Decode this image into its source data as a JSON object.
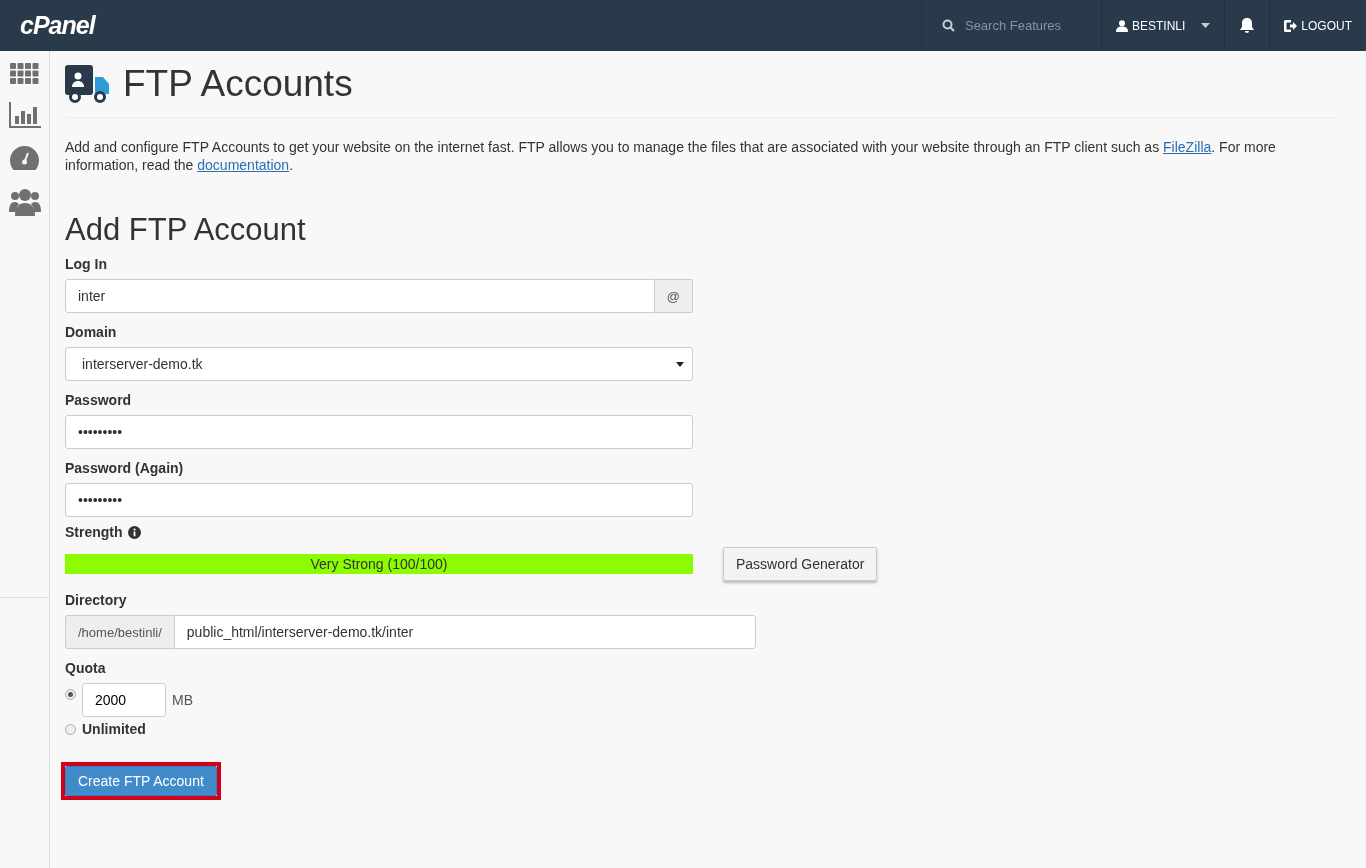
{
  "header": {
    "logo": "cPanel",
    "search": {
      "placeholder": "Search Features"
    },
    "user": "BESTINLI",
    "logout": "LOGOUT"
  },
  "page": {
    "title": "FTP Accounts",
    "intro": [
      {
        "kind": "text",
        "text": "Add and configure FTP Accounts to get your website on the internet fast. FTP allows you to manage the files that are associated with your website through an FTP client such as "
      },
      {
        "kind": "link",
        "text": "FileZilla"
      },
      {
        "kind": "text",
        "text": ". For more information, read the "
      },
      {
        "kind": "link",
        "text": "documentation"
      },
      {
        "kind": "text",
        "text": "."
      }
    ]
  },
  "form": {
    "title": "Add FTP Account",
    "login": {
      "label": "Log In",
      "value": "inter",
      "addon": "@"
    },
    "domain": {
      "label": "Domain",
      "value": "interserver-demo.tk"
    },
    "password": {
      "label": "Password",
      "value": "•••••••••"
    },
    "password_again": {
      "label": "Password (Again)",
      "value": "•••••••••"
    },
    "strength": {
      "label": "Strength",
      "level": 1.0,
      "reading": "Very Strong (100/100)",
      "button": "Password Generator"
    },
    "directory": {
      "label": "Directory",
      "prefix": "/home/bestinli/",
      "value": "public_html/interserver-demo.tk/inter"
    },
    "quota": {
      "label": "Quota",
      "options": [
        {
          "kind": "amount",
          "selected": true,
          "value": "2000",
          "unit": "MB"
        },
        {
          "kind": "unlimited",
          "selected": false,
          "label": "Unlimited"
        }
      ]
    },
    "submit": {
      "label": "Create FTP Account",
      "highlighted": true
    }
  }
}
